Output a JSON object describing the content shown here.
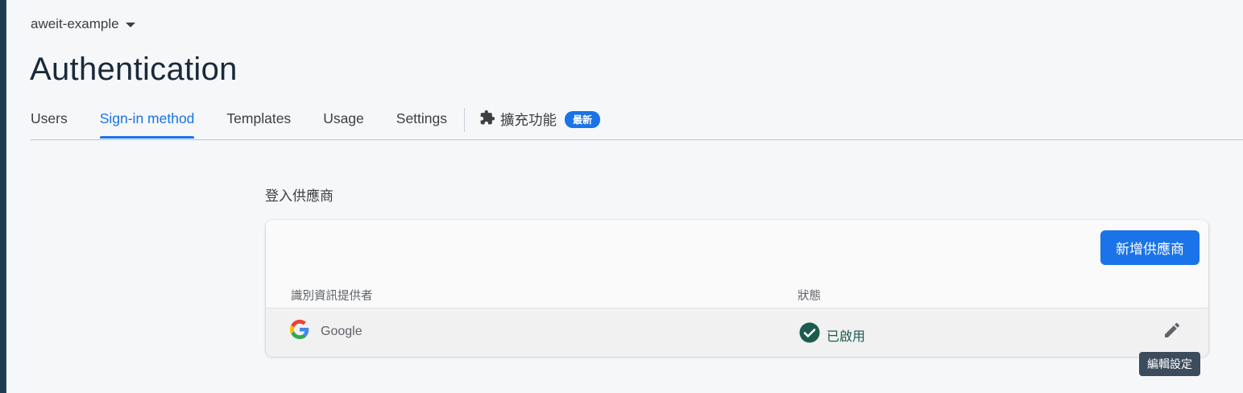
{
  "project": {
    "name": "aweit-example"
  },
  "page": {
    "title": "Authentication"
  },
  "tabs": [
    {
      "label": "Users"
    },
    {
      "label": "Sign-in method"
    },
    {
      "label": "Templates"
    },
    {
      "label": "Usage"
    },
    {
      "label": "Settings"
    }
  ],
  "extensions_tab": {
    "label": "擴充功能",
    "badge": "最新",
    "icon": "puzzle-icon"
  },
  "section": {
    "label": "登入供應商"
  },
  "providers_card": {
    "add_button_label": "新增供應商",
    "columns": {
      "provider": "識別資訊提供者",
      "status": "狀態"
    },
    "rows": [
      {
        "provider": "Google",
        "provider_icon": "google-logo-icon",
        "status": "已啟用",
        "status_icon": "check-circle-icon"
      }
    ]
  },
  "tooltip": {
    "text": "編輯設定"
  },
  "colors": {
    "accent": "#1a73e8",
    "status_green": "#1e5b4f"
  }
}
